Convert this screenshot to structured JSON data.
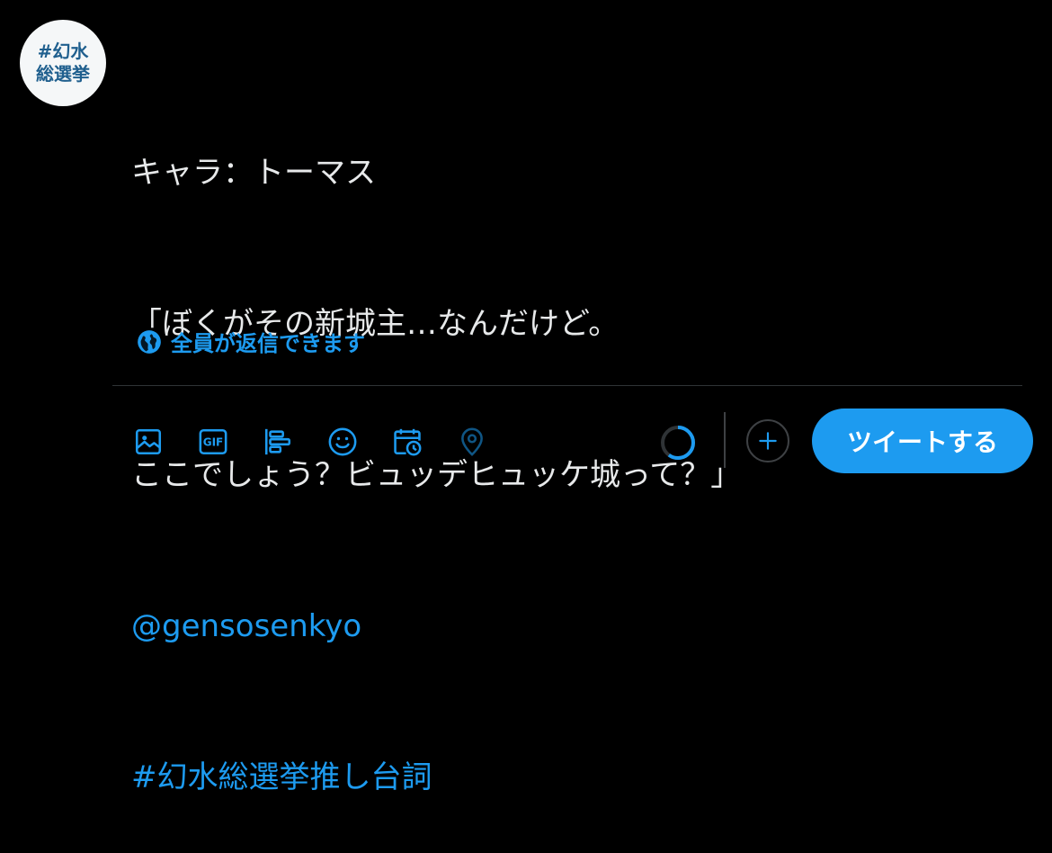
{
  "avatar": {
    "line1": "#幻水",
    "line2": "総選挙"
  },
  "tweet": {
    "lines": [
      "キャラ：トーマス",
      "「ぼくがその新城主…なんだけど。",
      "ここでしょう？ビュッデヒュッケ城って？」"
    ],
    "mention": "@gensosenkyo",
    "hashtag": "#幻水総選挙推し台詞"
  },
  "reply_setting": {
    "label": "全員が返信できます",
    "icon": "globe-icon"
  },
  "toolbar": {
    "icons": [
      "image-icon",
      "gif-icon",
      "poll-icon",
      "emoji-icon",
      "schedule-icon",
      "location-icon"
    ],
    "gif_label": "GIF",
    "progress": 0.6,
    "add_icon": "plus-icon",
    "tweet_label": "ツイートする"
  },
  "colors": {
    "accent": "#1d9bf0",
    "background": "#000000",
    "text": "#e7e9ea",
    "border": "#2f3336"
  }
}
